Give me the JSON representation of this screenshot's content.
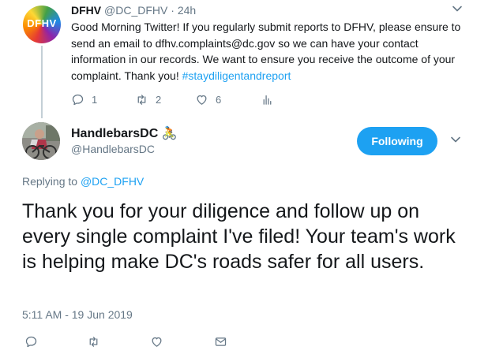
{
  "parent_tweet": {
    "avatar_text": "DFHV",
    "name": "DFHV",
    "handle": "@DC_DFHV",
    "separator": "·",
    "time": "24h",
    "text": "Good Morning Twitter! If you regularly submit reports to DFHV, please ensure to send an email to dfhv.complaints@dc.gov so we can have your contact information in our records. We want to ensure you receive the outcome of your complaint. Thank you! ",
    "hashtag": "#staydiligentandreport",
    "reply_count": "1",
    "retweet_count": "2",
    "like_count": "6"
  },
  "main_tweet": {
    "name": "HandlebarsDC",
    "name_emoji": "🚴",
    "handle": "@HandlebarsDC",
    "follow_label": "Following",
    "replying_prefix": "Replying to ",
    "replying_mention": "@DC_DFHV",
    "text": "Thank you for your diligence and follow up on every single complaint I've filed! Your team's work is helping make DC's roads safer for all users.",
    "timestamp": "5:11 AM - 19 Jun 2019"
  },
  "icons": {
    "caret": "chevron-down-icon",
    "reply": "reply-icon",
    "retweet": "retweet-icon",
    "like": "heart-icon",
    "analytics": "analytics-icon",
    "dm": "mail-icon"
  },
  "colors": {
    "accent": "#1da1f2",
    "muted": "#657786",
    "text": "#14171a",
    "thread_line": "#c4cfd6"
  }
}
